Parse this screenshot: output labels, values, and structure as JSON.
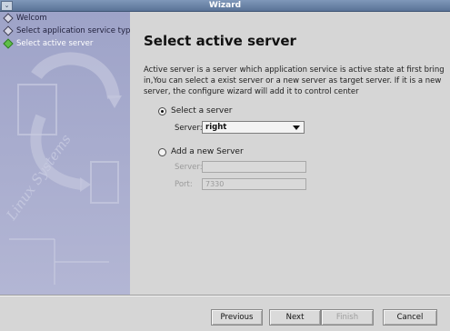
{
  "window": {
    "title": "Wizard",
    "menu_glyph": "⌄"
  },
  "steps": [
    {
      "label": "Welcom",
      "active": false
    },
    {
      "label": "Select application service type",
      "active": false
    },
    {
      "label": "Select active server",
      "active": true
    }
  ],
  "page": {
    "title": "Select active server",
    "description": "Active server is a server which application service is active state at first bring in,You can select a exist server or a new server as target server. If it is a new server, the configure wizard will add it to control center"
  },
  "select_existing": {
    "label": "Select a server",
    "checked": true,
    "server_label": "Server:",
    "server_value": "right"
  },
  "add_new": {
    "label": "Add a new Server",
    "checked": false,
    "server_label": "Server:",
    "server_value": "",
    "port_label": "Port:",
    "port_value": "7330"
  },
  "buttons": {
    "previous": "Previous",
    "next": "Next",
    "finish": "Finish",
    "cancel": "Cancel"
  },
  "sidebar_watermark": "Linux Systems"
}
